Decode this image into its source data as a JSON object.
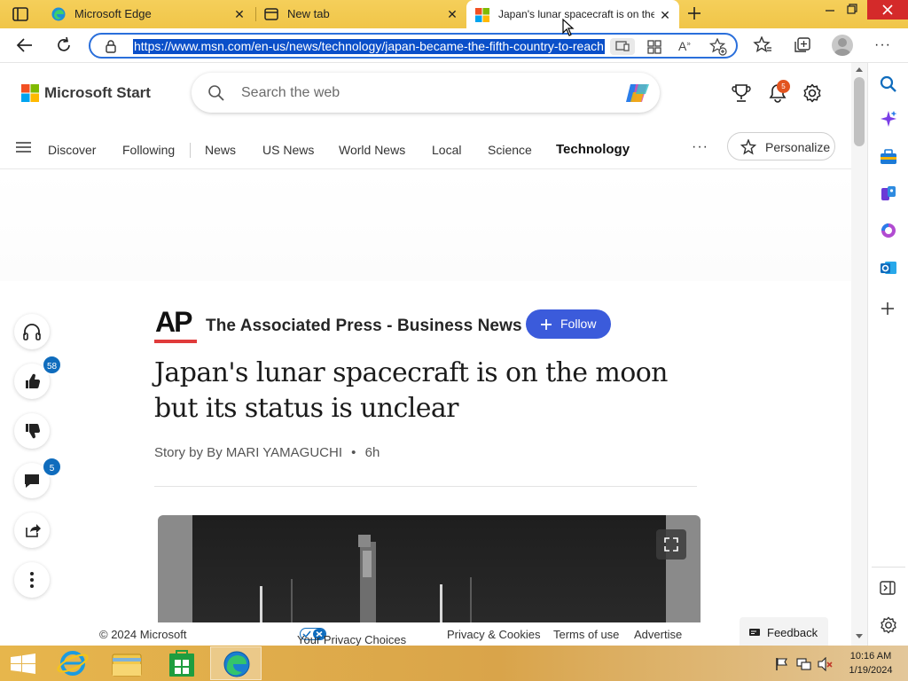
{
  "browser": {
    "tabs": [
      {
        "title": "Microsoft Edge",
        "icon": "edge-icon"
      },
      {
        "title": "New tab",
        "icon": "new-tab-icon"
      },
      {
        "title": "Japan's lunar spacecraft is on the",
        "icon": "msn-icon"
      }
    ],
    "url": "https://www.msn.com/en-us/news/technology/japan-became-the-fifth-country-to-reach"
  },
  "msn": {
    "brand": "Microsoft Start",
    "search_placeholder": "Search the web",
    "notification_count": "5",
    "nav": [
      "Discover",
      "Following",
      "News",
      "US News",
      "World News",
      "Local",
      "Science",
      "Technology"
    ],
    "active_nav": "Technology",
    "more_label": "···",
    "personalize_label": "Personalize"
  },
  "article": {
    "publisher_logo": "AP",
    "publisher": "The Associated Press - Business News",
    "follow_label": "Follow",
    "headline": "Japan's lunar spacecraft is on the moon but its status is unclear",
    "byline": "Story by By MARI YAMAGUCHI",
    "dot": "•",
    "age": "6h",
    "likes": "58",
    "comments": "5"
  },
  "footer": {
    "copyright": "© 2024 Microsoft",
    "privacy_choices": "Your Privacy Choices",
    "privacy_cookies": "Privacy & Cookies",
    "terms": "Terms of use",
    "advertise": "Advertise",
    "feedback": "Feedback"
  },
  "taskbar": {
    "time": "10:16 AM",
    "date": "1/19/2024"
  },
  "colors": {
    "titlebar": "#f0c548",
    "accent_blue": "#2a6fdb",
    "follow_button": "#3b5bdb",
    "badge": "#0f6cbd"
  }
}
